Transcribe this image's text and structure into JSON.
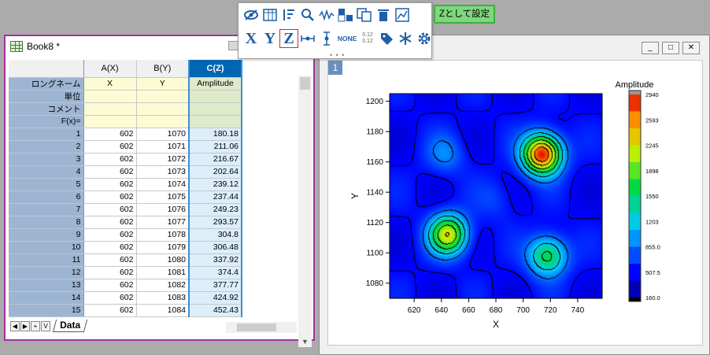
{
  "workbook": {
    "title": "Book8 *",
    "columns": [
      {
        "header": "A(X)",
        "long_name": "X"
      },
      {
        "header": "B(Y)",
        "long_name": "Y"
      },
      {
        "header": "C(Z)",
        "long_name": "Amplitude"
      }
    ],
    "meta_labels": [
      "ロングネーム",
      "単位",
      "コメント",
      "F(x)="
    ],
    "rows": [
      {
        "n": "1",
        "a": "602",
        "b": "1070",
        "c": "180.18"
      },
      {
        "n": "2",
        "a": "602",
        "b": "1071",
        "c": "211.06"
      },
      {
        "n": "3",
        "a": "602",
        "b": "1072",
        "c": "216.67"
      },
      {
        "n": "4",
        "a": "602",
        "b": "1073",
        "c": "202.64"
      },
      {
        "n": "5",
        "a": "602",
        "b": "1074",
        "c": "239.12"
      },
      {
        "n": "6",
        "a": "602",
        "b": "1075",
        "c": "237.44"
      },
      {
        "n": "7",
        "a": "602",
        "b": "1076",
        "c": "249.23"
      },
      {
        "n": "8",
        "a": "602",
        "b": "1077",
        "c": "293.57"
      },
      {
        "n": "9",
        "a": "602",
        "b": "1078",
        "c": "304.8"
      },
      {
        "n": "10",
        "a": "602",
        "b": "1079",
        "c": "306.48"
      },
      {
        "n": "11",
        "a": "602",
        "b": "1080",
        "c": "337.92"
      },
      {
        "n": "12",
        "a": "602",
        "b": "1081",
        "c": "374.4"
      },
      {
        "n": "13",
        "a": "602",
        "b": "1082",
        "c": "377.77"
      },
      {
        "n": "14",
        "a": "602",
        "b": "1083",
        "c": "424.92"
      },
      {
        "n": "15",
        "a": "602",
        "b": "1084",
        "c": "452.43"
      }
    ],
    "sheet_tab": "Data",
    "nav_buttons": [
      "◀",
      "▶",
      "+",
      "V"
    ]
  },
  "toolbar": {
    "row1_icons": [
      "hide-icon",
      "columns-icon",
      "sort-icon",
      "search-icon",
      "signal-icon",
      "abc-icon",
      "copy-icon",
      "trash-icon",
      "chart-icon"
    ],
    "row2_labels": {
      "x": "X",
      "y": "Y",
      "z": "Z",
      "none": "NONE",
      "dec_top": "0.12",
      "dec_bottom": "0.12"
    },
    "row2_icons": [
      "xerr-icon",
      "yerr-icon",
      "tag-icon",
      "snowflake-icon",
      "gear-icon"
    ],
    "tooltip": "Zとして設定"
  },
  "graph": {
    "layer_number": "1",
    "window_buttons": [
      "_",
      "□",
      "✕"
    ]
  },
  "chart_data": {
    "type": "heatmap",
    "xlabel": "X",
    "ylabel": "Y",
    "x_ticks": [
      620,
      640,
      660,
      680,
      700,
      720,
      740
    ],
    "y_ticks": [
      1080,
      1100,
      1120,
      1140,
      1160,
      1180,
      1200
    ],
    "xlim": [
      602,
      758
    ],
    "ylim": [
      1070,
      1205
    ],
    "colorbar_title": "Amplitude",
    "colorbar_ticks": [
      "2940",
      "2593",
      "2245",
      "1898",
      "1550",
      "1203",
      "855.0",
      "507.5",
      "160.0"
    ],
    "colorbar_range": [
      160,
      2940
    ],
    "peaks": [
      {
        "x": 714,
        "y": 1165,
        "amplitude": 2940
      },
      {
        "x": 645,
        "y": 1112,
        "amplitude": 2200
      },
      {
        "x": 718,
        "y": 1098,
        "amplitude": 1700
      },
      {
        "x": 643,
        "y": 1165,
        "amplitude": 900
      },
      {
        "x": 680,
        "y": 1135,
        "amplitude": 700
      }
    ],
    "base_amplitude": 500,
    "contour_lines": true
  }
}
